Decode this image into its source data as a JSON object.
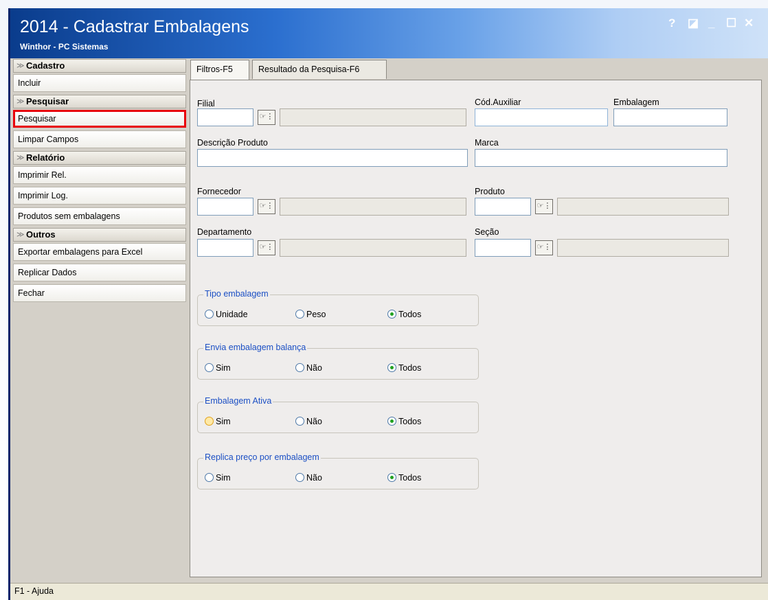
{
  "window": {
    "title": "2014 - Cadastrar Embalagens",
    "subtitle": "Winthor - PC Sistemas",
    "controls": {
      "help": "?",
      "restore": "◪",
      "minimize": "_",
      "maximize": "☐",
      "close": "✕"
    }
  },
  "sidebar": {
    "sections": [
      {
        "title": "Cadastro",
        "buttons": [
          "Incluir"
        ]
      },
      {
        "title": "Pesquisar",
        "buttons": [
          "Pesquisar",
          "Limpar Campos"
        ]
      },
      {
        "title": "Relatório",
        "buttons": [
          "Imprimir Rel.",
          "Imprimir Log.",
          "Produtos sem embalagens"
        ]
      },
      {
        "title": "Outros",
        "buttons": [
          "Exportar embalagens para Excel",
          "Replicar Dados",
          "Fechar"
        ]
      }
    ]
  },
  "tabs": [
    "Filtros-F5",
    "Resultado da Pesquisa-F6"
  ],
  "filters": {
    "filial": "Filial",
    "cod_auxiliar": "Cód.Auxiliar",
    "embalagem": "Embalagem",
    "descricao": "Descrição Produto",
    "marca": "Marca",
    "fornecedor": "Fornecedor",
    "produto": "Produto",
    "departamento": "Departamento",
    "secao": "Seção"
  },
  "groups": [
    {
      "title": "Tipo embalagem",
      "options": [
        "Unidade",
        "Peso",
        "Todos"
      ],
      "selected": "Todos"
    },
    {
      "title": "Envia embalagem balança",
      "options": [
        "Sim",
        "Não",
        "Todos"
      ],
      "selected": "Todos"
    },
    {
      "title": "Embalagem Ativa",
      "options": [
        "Sim",
        "Não",
        "Todos"
      ],
      "selected": "Todos"
    },
    {
      "title": "Replica preço por embalagem",
      "options": [
        "Sim",
        "Não",
        "Todos"
      ],
      "selected": "Todos"
    }
  ],
  "status_bar": "F1 - Ajuda",
  "colors": {
    "title_bar": "#2b6fcf",
    "highlight_border": "#e8000b",
    "group_title": "#1b4fc4",
    "radio_selected": "#21a121"
  },
  "icons": {
    "picker": "lookup-icon"
  }
}
